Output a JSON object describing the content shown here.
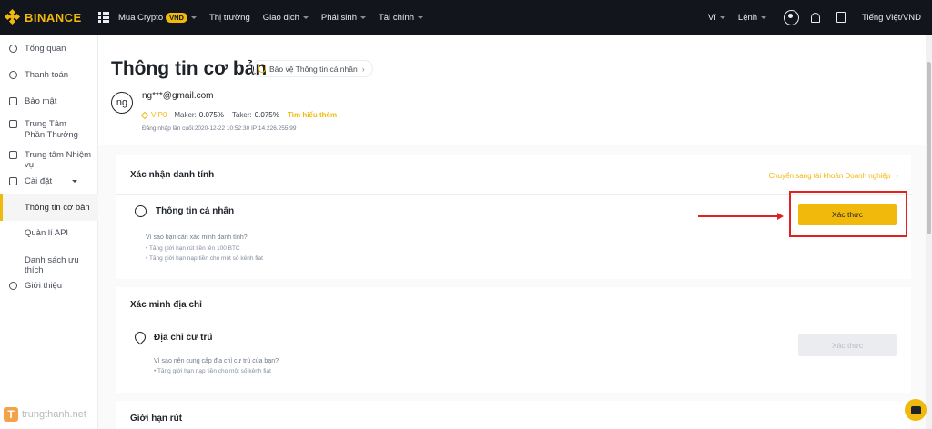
{
  "topbar": {
    "logo": "BINANCE",
    "nav": [
      "Mua Crypto",
      "Thị trường",
      "Giao dịch",
      "Phái sinh",
      "Tài chính"
    ],
    "vnd_badge": "VND",
    "wallet": "Ví",
    "orders": "Lệnh",
    "language": "Tiếng Việt/VND"
  },
  "sidebar": {
    "items": [
      "Tổng quan",
      "Thanh toán",
      "Bảo mật",
      "Trung Tâm Phần Thưởng",
      "Trung tâm Nhiệm vụ",
      "Cài đặt",
      "Thông tin cơ bản",
      "Quản lí API",
      "Danh sách ưu thích",
      "Giới thiệu"
    ]
  },
  "profile": {
    "title": "Thông tin cơ bản",
    "protect_link": "Bảo vệ Thông tin cá nhân",
    "avatar": "ng",
    "email": "ng***@gmail.com",
    "vip": "VIP0",
    "maker_label": "Maker:",
    "maker_value": "0.075%",
    "taker_label": "Taker:",
    "taker_value": "0.075%",
    "learn_more": "Tìm hiểu thêm",
    "last_login": "Đăng nhập lần cuối:2020-12-22 10:52:30  IP:14.226.255.99"
  },
  "identity": {
    "heading": "Xác nhận danh tính",
    "business_link": "Chuyển sang tài khoản Doanh nghiệp",
    "row_title": "Thông tin cá nhân",
    "why": "Vì sao bạn cần xác minh danh tính?",
    "bullet1": "• Tăng giới hạn rút tiền lên 100 BTC",
    "bullet2": "• Tăng giới hạn nạp tiền cho một số kênh fiat",
    "button": "Xác thực"
  },
  "address": {
    "heading": "Xác minh địa chỉ",
    "row_title": "Địa chỉ cư trú",
    "why": "Vì sao nên cung cấp địa chỉ cư trú của bạn?",
    "bullet1": "• Tăng giới hạn nạp tiền cho một số kênh fiat",
    "button": "Xác thực"
  },
  "withdraw": {
    "heading": "Giới hạn rút"
  },
  "watermark": {
    "logo": "T",
    "text": "trungthanh.net"
  },
  "colors": {
    "accent": "#f0b90b",
    "nav_bg": "#12161c",
    "annotation": "#e02121"
  }
}
